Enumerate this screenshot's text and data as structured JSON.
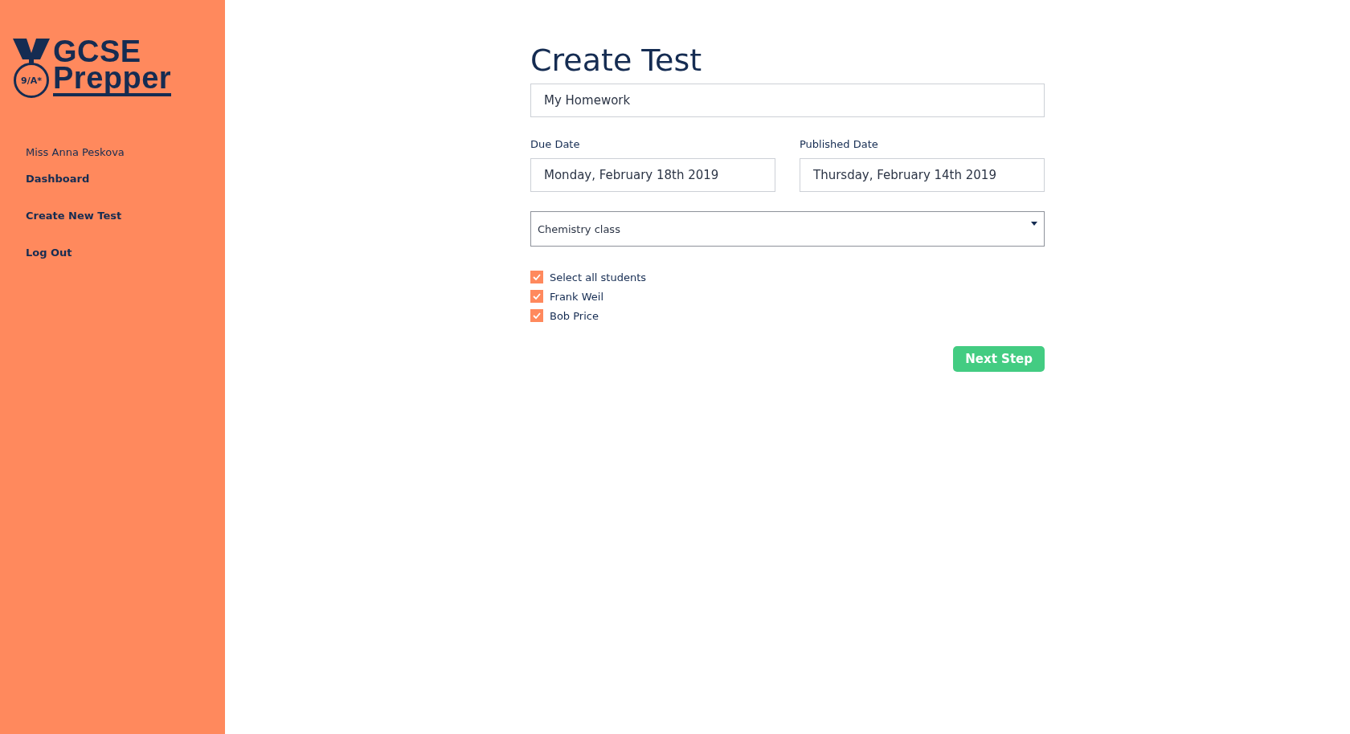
{
  "sidebar": {
    "logo": {
      "badge": "9/A*",
      "line1": "GCSE",
      "line2": "Prepper"
    },
    "user": "Miss Anna Peskova",
    "items": [
      {
        "label": "Dashboard"
      },
      {
        "label": "Create New Test"
      },
      {
        "label": "Log Out"
      }
    ]
  },
  "form": {
    "title": "Create Test",
    "test_name": {
      "value": "My Homework"
    },
    "dates": [
      {
        "label": "Due Date",
        "value": "Monday, February 18th 2019"
      },
      {
        "label": "Published Date",
        "value": "Thursday, February 14th 2019"
      }
    ],
    "class_select": {
      "value": "Chemistry class"
    },
    "students": [
      {
        "label": "Select all students",
        "checked": true
      },
      {
        "label": "Frank Weil",
        "checked": true
      },
      {
        "label": "Bob Price",
        "checked": true
      }
    ],
    "button": "Next Step"
  }
}
